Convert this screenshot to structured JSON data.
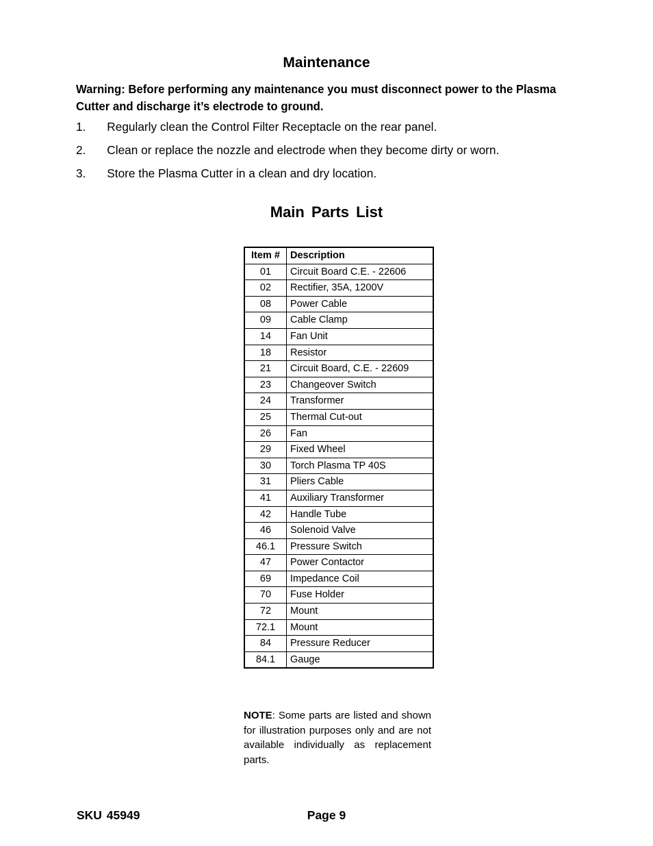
{
  "document": {
    "section_heading": "Maintenance",
    "warning": "Warning: Before performing any maintenance you must disconnect power to the Plasma Cutter and discharge it’s electrode to ground.",
    "maintenance_steps": [
      {
        "number": "1.",
        "text": "Regularly clean the Control Filter Receptacle on the rear panel."
      },
      {
        "number": "2.",
        "text": "Clean or replace the nozzle and electrode when they become dirty or worn."
      },
      {
        "number": "3.",
        "text": "Store the Plasma Cutter in a clean and dry location."
      }
    ],
    "parts_heading": "Main Parts List",
    "parts_table": {
      "columns": [
        "Item #",
        "Description"
      ],
      "rows": [
        {
          "item": "01",
          "description": "Circuit Board C.E. - 22606"
        },
        {
          "item": "02",
          "description": "Rectifier, 35A, 1200V"
        },
        {
          "item": "08",
          "description": "Power Cable"
        },
        {
          "item": "09",
          "description": "Cable Clamp"
        },
        {
          "item": "14",
          "description": "Fan Unit"
        },
        {
          "item": "18",
          "description": "Resistor"
        },
        {
          "item": "21",
          "description": "Circuit Board, C.E. - 22609"
        },
        {
          "item": "23",
          "description": "Changeover Switch"
        },
        {
          "item": "24",
          "description": "Transformer"
        },
        {
          "item": "25",
          "description": "Thermal Cut-out"
        },
        {
          "item": "26",
          "description": "Fan"
        },
        {
          "item": "29",
          "description": "Fixed Wheel"
        },
        {
          "item": "30",
          "description": "Torch Plasma TP 40S"
        },
        {
          "item": "31",
          "description": "Pliers Cable"
        },
        {
          "item": "41",
          "description": "Auxiliary Transformer"
        },
        {
          "item": "42",
          "description": "Handle Tube"
        },
        {
          "item": "46",
          "description": "Solenoid Valve"
        },
        {
          "item": "46.1",
          "description": "Pressure Switch"
        },
        {
          "item": "47",
          "description": "Power Contactor"
        },
        {
          "item": "69",
          "description": "Impedance Coil"
        },
        {
          "item": "70",
          "description": "Fuse Holder"
        },
        {
          "item": "72",
          "description": "Mount"
        },
        {
          "item": "72.1",
          "description": "Mount"
        },
        {
          "item": "84",
          "description": "Pressure Reducer"
        },
        {
          "item": "84.1",
          "description": "Gauge"
        }
      ]
    },
    "note": {
      "label": "NOTE",
      "body": ": Some parts are listed and shown for illustration purposes only and are not available individually as replacement parts."
    },
    "footer": {
      "sku": "SKU 45949",
      "page": "Page 9"
    }
  }
}
